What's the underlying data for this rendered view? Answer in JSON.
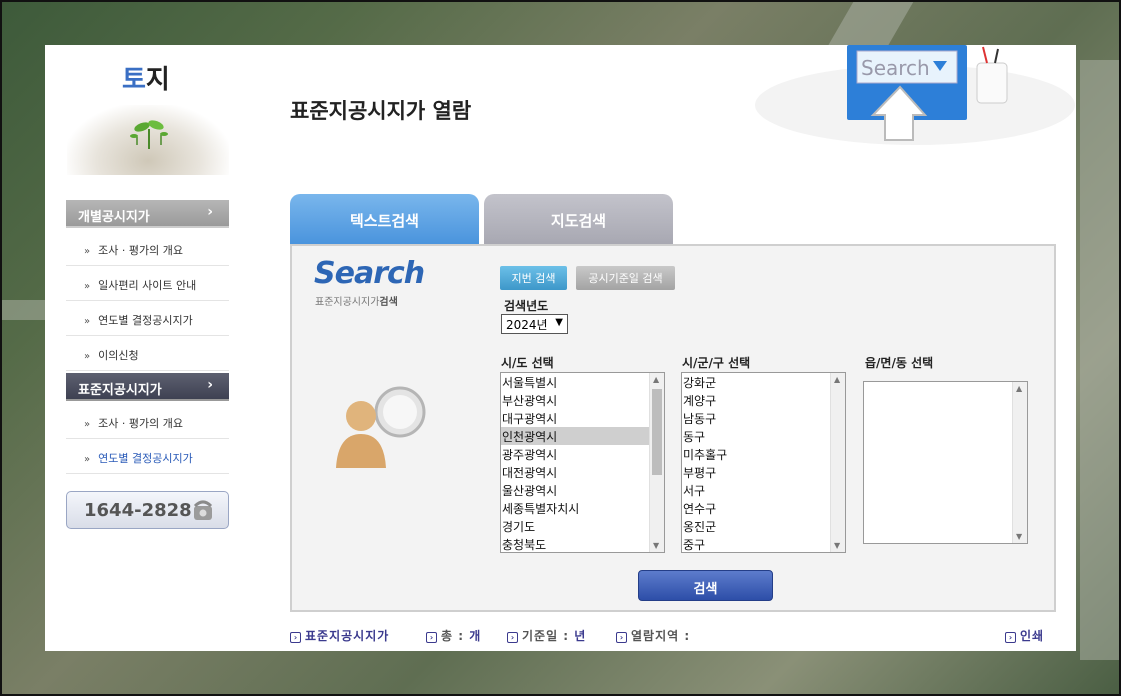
{
  "brand": {
    "part1": "토",
    "part2": "지"
  },
  "page_title": "표준지공시지가 열람",
  "header_deco": {
    "search_text": "Search"
  },
  "sidebar": {
    "sections": [
      {
        "label": "개별공시지가",
        "arrow": "›"
      },
      {
        "label": "표준지공시지가",
        "arrow": "›"
      }
    ],
    "group1_items": [
      {
        "label": "조사 · 평가의 개요"
      },
      {
        "label": "일사편리 사이트 안내"
      },
      {
        "label": "연도별 결정공시지가"
      },
      {
        "label": "이의신청"
      }
    ],
    "group2_items": [
      {
        "label": "조사 · 평가의 개요"
      },
      {
        "label": "연도별 결정공시지가"
      }
    ],
    "phone": "1644-2828"
  },
  "tabs": [
    {
      "label": "텍스트검색",
      "active": true
    },
    {
      "label": "지도검색",
      "active": false
    }
  ],
  "panel": {
    "logo": "Search",
    "logo_sub_a": "표준지공시지가",
    "logo_sub_b": "검색",
    "buttons": {
      "lot": "지번 검색",
      "date": "공시기준일 검색"
    },
    "year_label": "검색년도",
    "year_value": "2024년",
    "sido_label": "시/도 선택",
    "sigungu_label": "시/군/구 선택",
    "eupmyeon_label": "읍/면/동 선택",
    "sido_options": [
      "서울특별시",
      "부산광역시",
      "대구광역시",
      "인천광역시",
      "광주광역시",
      "대전광역시",
      "울산광역시",
      "세종특별자치시",
      "경기도",
      "충청북도"
    ],
    "sido_selected": "인천광역시",
    "sigungu_options": [
      "강화군",
      "계양구",
      "남동구",
      "동구",
      "미추홀구",
      "부평구",
      "서구",
      "연수구",
      "옹진군",
      "중구"
    ],
    "search_button": "검색"
  },
  "info_bar": {
    "type_label": "표준지공시지가",
    "total_label": "총 :",
    "total_unit": "개",
    "date_label": "기준일 :",
    "date_unit": "년",
    "area_label": "열람지역 :",
    "print_label": "인쇄"
  },
  "colors": {
    "accent_blue": "#4a94dd",
    "nav_dark": "#3e4152",
    "button_blue": "#2d4ea8"
  }
}
